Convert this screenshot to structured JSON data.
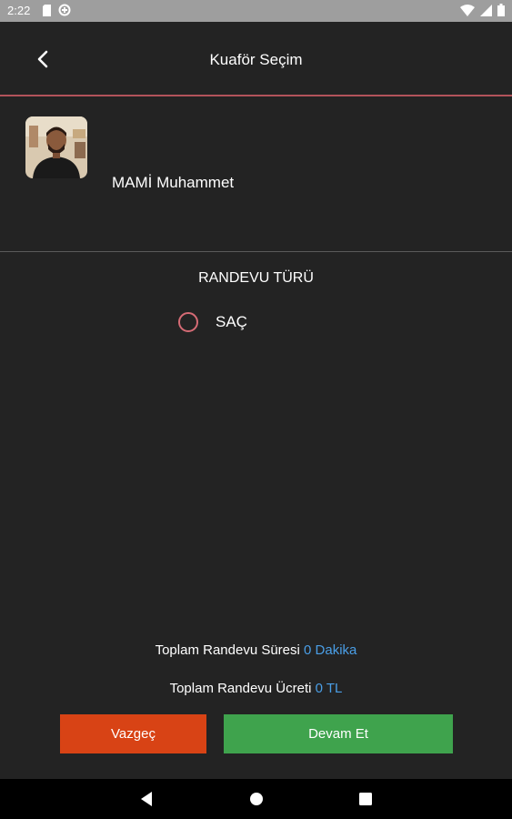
{
  "status_bar": {
    "time": "2:22"
  },
  "toolbar": {
    "title": "Kuaför Seçim"
  },
  "barber": {
    "name": "MAMİ Muhammet"
  },
  "appointment": {
    "section_title": "RANDEVU TÜRÜ",
    "options": [
      {
        "label": "SAÇ",
        "selected": false
      }
    ]
  },
  "summary": {
    "duration_label": "Toplam Randevu Süresi",
    "duration_value": "0 Dakika",
    "price_label": "Toplam Randevu Ücreti",
    "price_value": "0 TL"
  },
  "buttons": {
    "cancel": "Vazgeç",
    "continue": "Devam Et"
  },
  "colors": {
    "background": "#232323",
    "accent_line": "#b2535b",
    "radio": "#d56b75",
    "value_text": "#4a9ee6",
    "cancel_button": "#d84315",
    "continue_button": "#3fa34d"
  },
  "icons": {
    "status": [
      "sd-card-icon",
      "data-saver-icon",
      "wifi-icon",
      "signal-icon",
      "battery-icon"
    ],
    "toolbar": "back-arrow-icon",
    "nav": [
      "nav-back-icon",
      "nav-home-icon",
      "nav-recents-icon"
    ]
  }
}
